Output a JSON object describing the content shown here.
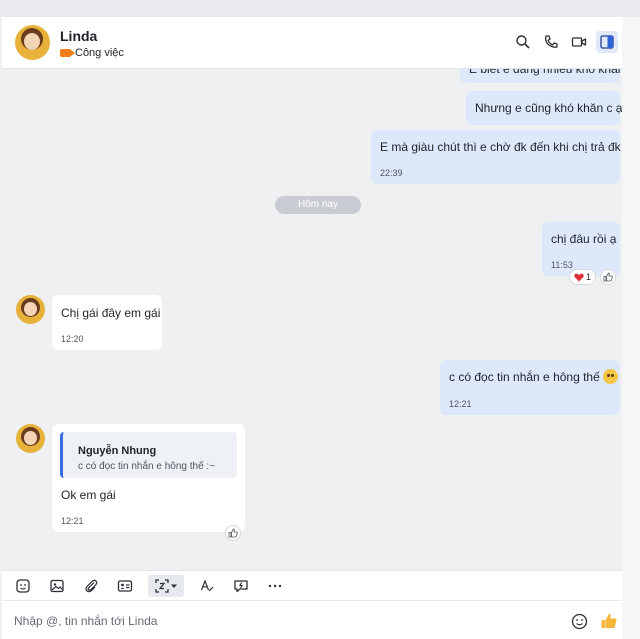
{
  "header": {
    "name": "Linda",
    "status": "Công việc"
  },
  "messages": {
    "m0_partial": "E biết e đang nhiều khó khăn",
    "m1": "Nhưng e cũng khó khăn c ạ",
    "m2": "E mà giàu chút thì e chờ đk đến khi chị trả đk ý",
    "m2_time": "22:39",
    "divider": "Hôm nay",
    "m3": "chị đâu rồi ạ",
    "m3_time": "11:53",
    "m3_reaction_count": "1",
    "m4": "Chị gái đây em gái",
    "m4_time": "12:20",
    "m5": "c có đọc tin nhắn e hông thế",
    "m5_time": "12:21",
    "m6_quote_name": "Nguyễn Nhung",
    "m6_quote_text": "c có đọc tin nhắn e hông thế :~",
    "m6": "Ok em gái",
    "m6_time": "12:21"
  },
  "composer": {
    "placeholder": "Nhập @, tin nhắn tới Linda"
  },
  "icons": {
    "search": "search-icon",
    "call": "phone-icon",
    "video": "video-icon",
    "sidebar": "sidebar-toggle-icon",
    "emoji": "emoji-icon",
    "image": "image-icon",
    "attach": "paperclip-icon",
    "contact_card": "contact-card-icon",
    "screenshot": "screenshot-icon",
    "format": "text-format-icon",
    "quick_reply": "quick-reply-icon",
    "more": "more-icon",
    "like": "thumbs-up-icon"
  },
  "colors": {
    "accent": "#3b6fe0",
    "my_bubble": "#dde8fa",
    "their_bubble": "#ffffff",
    "status_tag": "#f07c1b",
    "like": "#f5b63a"
  }
}
